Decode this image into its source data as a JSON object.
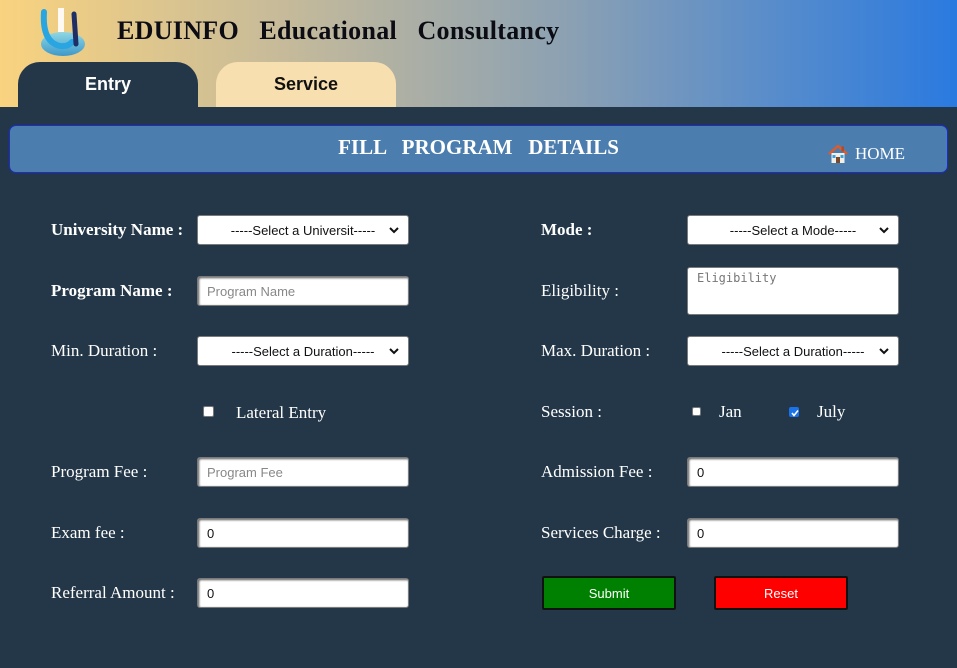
{
  "header": {
    "title": "EDUINFO   Educational   Consultancy",
    "logo_icon": "eduinfo-u-logo"
  },
  "tabs": [
    {
      "label": "Entry",
      "active": true
    },
    {
      "label": "Service",
      "active": false
    }
  ],
  "banner": {
    "title": "FILL   PROGRAM   DETAILS",
    "home_label": "HOME",
    "home_icon": "house-icon"
  },
  "form": {
    "university_label": "University Name :",
    "university_value": "-----Select a Universit-----",
    "program_name_label": "Program Name :",
    "program_name_placeholder": "Program Name",
    "min_duration_label": "Min. Duration :",
    "min_duration_value": "-----Select a Duration-----",
    "lateral_entry_label": "Lateral Entry",
    "lateral_entry_checked": false,
    "program_fee_label": "Program Fee :",
    "program_fee_placeholder": "Program Fee",
    "exam_fee_label": "Exam fee :",
    "exam_fee_value": "0",
    "referral_label": "Referral Amount :",
    "referral_value": "0",
    "mode_label": "Mode :",
    "mode_value": "-----Select a Mode-----",
    "eligibility_label": "Eligibility :",
    "eligibility_placeholder": "Eligibility",
    "max_duration_label": "Max. Duration :",
    "max_duration_value": "-----Select a Duration-----",
    "session_label": "Session :",
    "session_jan_label": "Jan",
    "session_jan_checked": false,
    "session_july_label": "July",
    "session_july_checked": true,
    "admission_fee_label": "Admission Fee :",
    "admission_fee_value": "0",
    "services_charge_label": "Services Charge :",
    "services_charge_value": "0",
    "submit_label": "Submit",
    "reset_label": "Reset"
  },
  "colors": {
    "background": "#243748",
    "banner": "#4b7eae",
    "submit": "#008000",
    "reset": "#ff0000",
    "service_tab": "#f8dfb0"
  }
}
